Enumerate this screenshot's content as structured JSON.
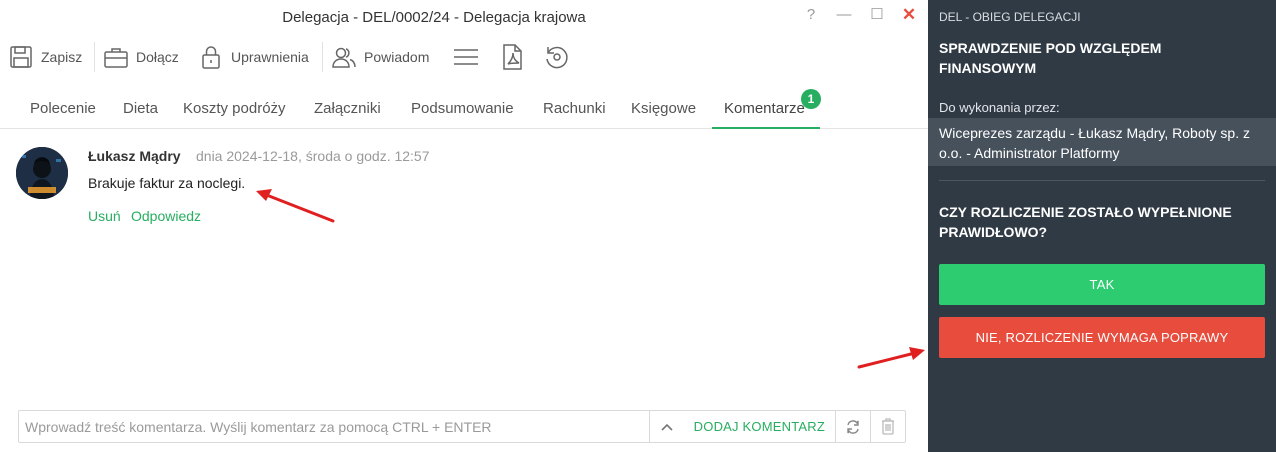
{
  "window": {
    "title": "Delegacja - DEL/0002/24 - Delegacja krajowa",
    "controls": {
      "help": "?",
      "minimize": "—",
      "maximize": "☐",
      "close": "✕"
    }
  },
  "toolbar": {
    "save_label": "Zapisz",
    "attach_label": "Dołącz",
    "permissions_label": "Uprawnienia",
    "notify_label": "Powiadom",
    "icons": [
      "menu-icon",
      "pdf-icon",
      "history-icon"
    ]
  },
  "tabs": {
    "items": [
      "Polecenie",
      "Dieta",
      "Koszty podróży",
      "Załączniki",
      "Podsumowanie",
      "Rachunki",
      "Księgowe",
      "Komentarze"
    ],
    "active": "Komentarze",
    "badge": "1"
  },
  "comment": {
    "author": "Łukasz Mądry",
    "date": "dnia 2024-12-18, środa o godz. 12:57",
    "text": "Brakuje faktur za noclegi.",
    "delete_label": "Usuń",
    "reply_label": "Odpowiedz"
  },
  "composer": {
    "placeholder": "Wprowadź treść komentarza. Wyślij komentarz za pomocą CTRL + ENTER",
    "value": "",
    "submit_label": "DODAJ KOMENTARZ"
  },
  "side_panel": {
    "header": "DEL - OBIEG DELEGACJI",
    "step_title": "SPRAWDZENIE POD WZGLĘDEM FINANSOWYM",
    "assignee_label": "Do wykonania przez:",
    "assignee": "Wiceprezes zarządu - Łukasz Mądry, Roboty sp. z o.o. - Administrator Platformy",
    "question": "CZY ROZLICZENIE ZOSTAŁO WYPEŁNIONE PRAWIDŁOWO?",
    "yes_label": "TAK",
    "no_label": "NIE, ROZLICZENIE WYMAGA POPRAWY"
  },
  "colors": {
    "accent": "#27ae60",
    "panel_bg": "#303a45",
    "yes_button": "#2ecc71",
    "no_button": "#e74c3c",
    "annotation_arrow": "#e02020"
  }
}
